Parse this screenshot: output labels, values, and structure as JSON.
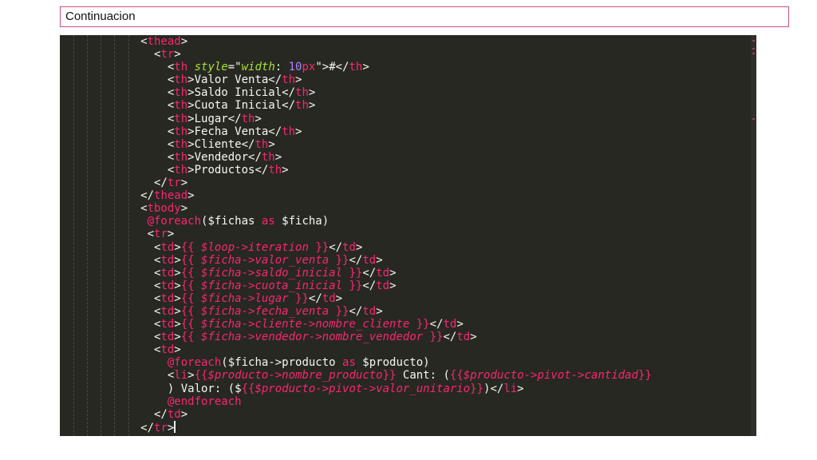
{
  "slide": {
    "title": "Continuacion"
  },
  "editor": {
    "lines": [
      [
        {
          "c": "t-punc",
          "t": "            <"
        },
        {
          "c": "t-tag",
          "t": "thead"
        },
        {
          "c": "t-punc",
          "t": ">"
        }
      ],
      [
        {
          "c": "t-punc",
          "t": "              <"
        },
        {
          "c": "t-tag",
          "t": "tr"
        },
        {
          "c": "t-punc",
          "t": ">"
        }
      ],
      [
        {
          "c": "t-punc",
          "t": "                <"
        },
        {
          "c": "t-tag",
          "t": "th"
        },
        {
          "c": "t-punc",
          "t": " "
        },
        {
          "c": "t-attr",
          "t": "style"
        },
        {
          "c": "t-punc",
          "t": "=\""
        },
        {
          "c": "t-attr",
          "t": "width"
        },
        {
          "c": "t-punc",
          "t": ": "
        },
        {
          "c": "t-num",
          "t": "10"
        },
        {
          "c": "t-kw",
          "t": "px"
        },
        {
          "c": "t-punc",
          "t": "\">#</"
        },
        {
          "c": "t-tag",
          "t": "th"
        },
        {
          "c": "t-punc",
          "t": ">"
        }
      ],
      [
        {
          "c": "t-punc",
          "t": "                <"
        },
        {
          "c": "t-tag",
          "t": "th"
        },
        {
          "c": "t-punc",
          "t": ">Valor Venta</"
        },
        {
          "c": "t-tag",
          "t": "th"
        },
        {
          "c": "t-punc",
          "t": ">"
        }
      ],
      [
        {
          "c": "t-punc",
          "t": "                <"
        },
        {
          "c": "t-tag",
          "t": "th"
        },
        {
          "c": "t-punc",
          "t": ">Saldo Inicial</"
        },
        {
          "c": "t-tag",
          "t": "th"
        },
        {
          "c": "t-punc",
          "t": ">"
        }
      ],
      [
        {
          "c": "t-punc",
          "t": "                <"
        },
        {
          "c": "t-tag",
          "t": "th"
        },
        {
          "c": "t-punc",
          "t": ">Cuota Inicial</"
        },
        {
          "c": "t-tag",
          "t": "th"
        },
        {
          "c": "t-punc",
          "t": ">"
        }
      ],
      [
        {
          "c": "t-punc",
          "t": "                <"
        },
        {
          "c": "t-tag",
          "t": "th"
        },
        {
          "c": "t-punc",
          "t": ">Lugar</"
        },
        {
          "c": "t-tag",
          "t": "th"
        },
        {
          "c": "t-punc",
          "t": ">"
        }
      ],
      [
        {
          "c": "t-punc",
          "t": "                <"
        },
        {
          "c": "t-tag",
          "t": "th"
        },
        {
          "c": "t-punc",
          "t": ">Fecha Venta</"
        },
        {
          "c": "t-tag",
          "t": "th"
        },
        {
          "c": "t-punc",
          "t": ">"
        }
      ],
      [
        {
          "c": "t-punc",
          "t": "                <"
        },
        {
          "c": "t-tag",
          "t": "th"
        },
        {
          "c": "t-punc",
          "t": ">Cliente</"
        },
        {
          "c": "t-tag",
          "t": "th"
        },
        {
          "c": "t-punc",
          "t": ">"
        }
      ],
      [
        {
          "c": "t-punc",
          "t": "                <"
        },
        {
          "c": "t-tag",
          "t": "th"
        },
        {
          "c": "t-punc",
          "t": ">Vendedor</"
        },
        {
          "c": "t-tag",
          "t": "th"
        },
        {
          "c": "t-punc",
          "t": ">"
        }
      ],
      [
        {
          "c": "t-punc",
          "t": "                <"
        },
        {
          "c": "t-tag",
          "t": "th"
        },
        {
          "c": "t-punc",
          "t": ">Productos</"
        },
        {
          "c": "t-tag",
          "t": "th"
        },
        {
          "c": "t-punc",
          "t": ">"
        }
      ],
      [
        {
          "c": "t-punc",
          "t": "              </"
        },
        {
          "c": "t-tag",
          "t": "tr"
        },
        {
          "c": "t-punc",
          "t": ">"
        }
      ],
      [
        {
          "c": "t-punc",
          "t": "            </"
        },
        {
          "c": "t-tag",
          "t": "thead"
        },
        {
          "c": "t-punc",
          "t": ">"
        }
      ],
      [
        {
          "c": "t-punc",
          "t": "            <"
        },
        {
          "c": "t-tag",
          "t": "tbody"
        },
        {
          "c": "t-punc",
          "t": ">"
        }
      ],
      [
        {
          "c": "t-punc",
          "t": "             "
        },
        {
          "c": "t-dir",
          "t": "@foreach"
        },
        {
          "c": "t-punc",
          "t": "($fichas "
        },
        {
          "c": "t-kw",
          "t": "as"
        },
        {
          "c": "t-punc",
          "t": " $ficha)"
        }
      ],
      [
        {
          "c": "t-punc",
          "t": "             <"
        },
        {
          "c": "t-tag",
          "t": "tr"
        },
        {
          "c": "t-punc",
          "t": ">"
        }
      ],
      [
        {
          "c": "t-punc",
          "t": "              <"
        },
        {
          "c": "t-tag",
          "t": "td"
        },
        {
          "c": "t-punc",
          "t": ">"
        },
        {
          "c": "t-tag",
          "t": "{{ "
        },
        {
          "c": "t-ital",
          "t": "$loop->iteration"
        },
        {
          "c": "t-tag",
          "t": " }}"
        },
        {
          "c": "t-punc",
          "t": "</"
        },
        {
          "c": "t-tag",
          "t": "td"
        },
        {
          "c": "t-punc",
          "t": ">"
        }
      ],
      [
        {
          "c": "t-punc",
          "t": "              <"
        },
        {
          "c": "t-tag",
          "t": "td"
        },
        {
          "c": "t-punc",
          "t": ">"
        },
        {
          "c": "t-tag",
          "t": "{{ "
        },
        {
          "c": "t-ital",
          "t": "$ficha->valor_venta"
        },
        {
          "c": "t-tag",
          "t": " }}"
        },
        {
          "c": "t-punc",
          "t": "</"
        },
        {
          "c": "t-tag",
          "t": "td"
        },
        {
          "c": "t-punc",
          "t": ">"
        }
      ],
      [
        {
          "c": "t-punc",
          "t": "              <"
        },
        {
          "c": "t-tag",
          "t": "td"
        },
        {
          "c": "t-punc",
          "t": ">"
        },
        {
          "c": "t-tag",
          "t": "{{ "
        },
        {
          "c": "t-ital",
          "t": "$ficha->saldo_inicial"
        },
        {
          "c": "t-tag",
          "t": " }}"
        },
        {
          "c": "t-punc",
          "t": "</"
        },
        {
          "c": "t-tag",
          "t": "td"
        },
        {
          "c": "t-punc",
          "t": ">"
        }
      ],
      [
        {
          "c": "t-punc",
          "t": "              <"
        },
        {
          "c": "t-tag",
          "t": "td"
        },
        {
          "c": "t-punc",
          "t": ">"
        },
        {
          "c": "t-tag",
          "t": "{{ "
        },
        {
          "c": "t-ital",
          "t": "$ficha->cuota_inicial"
        },
        {
          "c": "t-tag",
          "t": " }}"
        },
        {
          "c": "t-punc",
          "t": "</"
        },
        {
          "c": "t-tag",
          "t": "td"
        },
        {
          "c": "t-punc",
          "t": ">"
        }
      ],
      [
        {
          "c": "t-punc",
          "t": "              <"
        },
        {
          "c": "t-tag",
          "t": "td"
        },
        {
          "c": "t-punc",
          "t": ">"
        },
        {
          "c": "t-tag",
          "t": "{{ "
        },
        {
          "c": "t-ital",
          "t": "$ficha->lugar"
        },
        {
          "c": "t-tag",
          "t": " }}"
        },
        {
          "c": "t-punc",
          "t": "</"
        },
        {
          "c": "t-tag",
          "t": "td"
        },
        {
          "c": "t-punc",
          "t": ">"
        }
      ],
      [
        {
          "c": "t-punc",
          "t": "              <"
        },
        {
          "c": "t-tag",
          "t": "td"
        },
        {
          "c": "t-punc",
          "t": ">"
        },
        {
          "c": "t-tag",
          "t": "{{ "
        },
        {
          "c": "t-ital",
          "t": "$ficha->fecha_venta"
        },
        {
          "c": "t-tag",
          "t": " }}"
        },
        {
          "c": "t-punc",
          "t": "</"
        },
        {
          "c": "t-tag",
          "t": "td"
        },
        {
          "c": "t-punc",
          "t": ">"
        }
      ],
      [
        {
          "c": "t-punc",
          "t": "              <"
        },
        {
          "c": "t-tag",
          "t": "td"
        },
        {
          "c": "t-punc",
          "t": ">"
        },
        {
          "c": "t-tag",
          "t": "{{ "
        },
        {
          "c": "t-ital",
          "t": "$ficha->cliente->nombre_cliente"
        },
        {
          "c": "t-tag",
          "t": " }}"
        },
        {
          "c": "t-punc",
          "t": "</"
        },
        {
          "c": "t-tag",
          "t": "td"
        },
        {
          "c": "t-punc",
          "t": ">"
        }
      ],
      [
        {
          "c": "t-punc",
          "t": "              <"
        },
        {
          "c": "t-tag",
          "t": "td"
        },
        {
          "c": "t-punc",
          "t": ">"
        },
        {
          "c": "t-tag",
          "t": "{{ "
        },
        {
          "c": "t-ital",
          "t": "$ficha->vendedor->nombre_vendedor"
        },
        {
          "c": "t-tag",
          "t": " }}"
        },
        {
          "c": "t-punc",
          "t": "</"
        },
        {
          "c": "t-tag",
          "t": "td"
        },
        {
          "c": "t-punc",
          "t": ">"
        }
      ],
      [
        {
          "c": "t-punc",
          "t": "              <"
        },
        {
          "c": "t-tag",
          "t": "td"
        },
        {
          "c": "t-punc",
          "t": ">"
        }
      ],
      [
        {
          "c": "t-punc",
          "t": "                "
        },
        {
          "c": "t-dir",
          "t": "@foreach"
        },
        {
          "c": "t-punc",
          "t": "($ficha->producto "
        },
        {
          "c": "t-kw",
          "t": "as"
        },
        {
          "c": "t-punc",
          "t": " $producto)"
        }
      ],
      [
        {
          "c": "t-punc",
          "t": "                <"
        },
        {
          "c": "t-tag",
          "t": "li"
        },
        {
          "c": "t-punc",
          "t": ">"
        },
        {
          "c": "t-tag",
          "t": "{{"
        },
        {
          "c": "t-ital",
          "t": "$producto->nombre_producto"
        },
        {
          "c": "t-tag",
          "t": "}}"
        },
        {
          "c": "t-punc",
          "t": " Cant: ("
        },
        {
          "c": "t-tag",
          "t": "{{"
        },
        {
          "c": "t-ital",
          "t": "$producto->pivot->cantidad"
        },
        {
          "c": "t-tag",
          "t": "}}"
        }
      ],
      [
        {
          "c": "t-punc",
          "t": "                ) Valor: ($"
        },
        {
          "c": "t-tag",
          "t": "{{"
        },
        {
          "c": "t-ital",
          "t": "$producto->pivot->valor_unitario"
        },
        {
          "c": "t-tag",
          "t": "}}"
        },
        {
          "c": "t-punc",
          "t": ")</"
        },
        {
          "c": "t-tag",
          "t": "li"
        },
        {
          "c": "t-punc",
          "t": ">"
        }
      ],
      [
        {
          "c": "t-punc",
          "t": "                "
        },
        {
          "c": "t-dir",
          "t": "@endforeach"
        }
      ],
      [
        {
          "c": "t-punc",
          "t": "              </"
        },
        {
          "c": "t-tag",
          "t": "td"
        },
        {
          "c": "t-punc",
          "t": ">"
        }
      ],
      [
        {
          "c": "t-punc",
          "t": "            </"
        },
        {
          "c": "t-tag",
          "t": "tr"
        },
        {
          "c": "t-punc",
          "t": ">"
        },
        {
          "c": "cursor",
          "t": ""
        }
      ]
    ]
  }
}
